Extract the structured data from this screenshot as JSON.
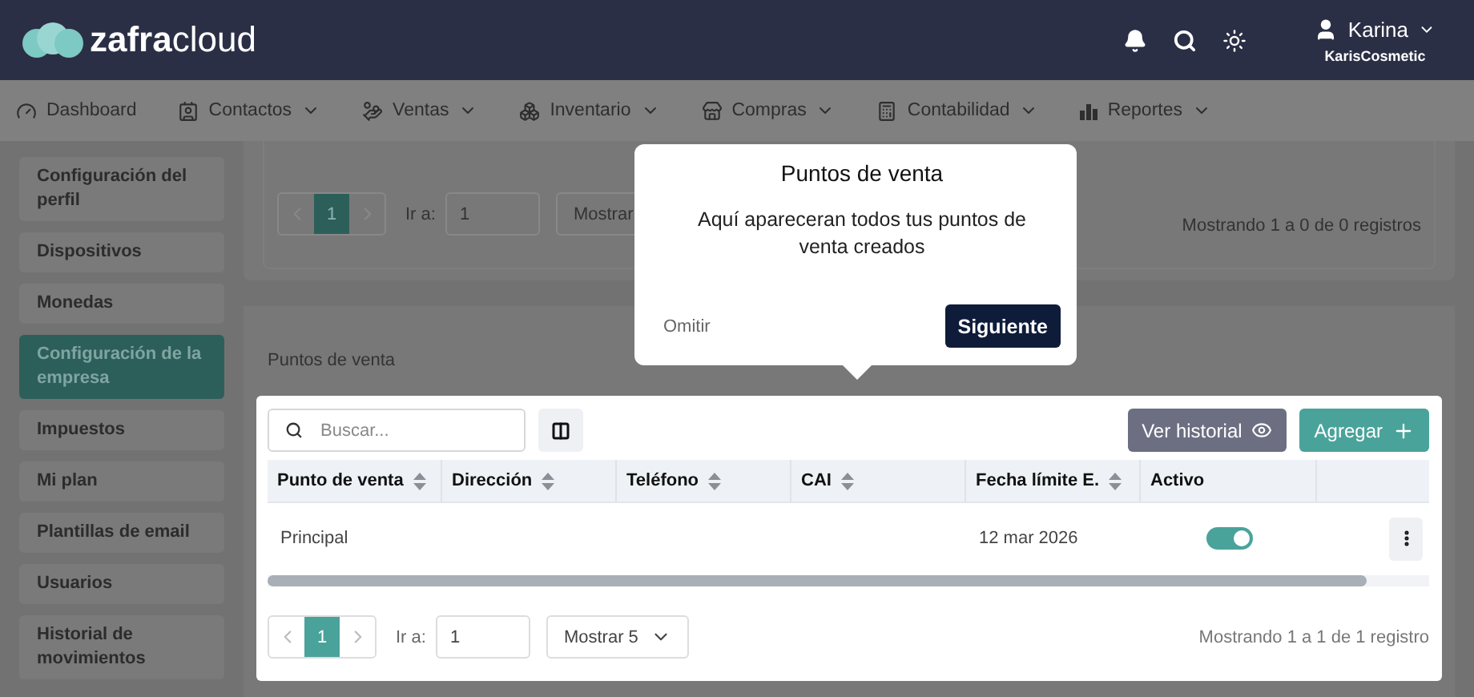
{
  "header": {
    "logo": {
      "bold": "zafra",
      "light": "cloud"
    },
    "user": {
      "name": "Karina",
      "company": "KarisCosmetic"
    }
  },
  "nav": [
    {
      "kind": "dashboard",
      "label": "Dashboard",
      "dropdown": false
    },
    {
      "kind": "contacts",
      "label": "Contactos",
      "dropdown": true
    },
    {
      "kind": "sales",
      "label": "Ventas",
      "dropdown": true
    },
    {
      "kind": "inventory",
      "label": "Inventario",
      "dropdown": true
    },
    {
      "kind": "purchases",
      "label": "Compras",
      "dropdown": true
    },
    {
      "kind": "accounting",
      "label": "Contabilidad",
      "dropdown": true
    },
    {
      "kind": "reports",
      "label": "Reportes",
      "dropdown": true
    }
  ],
  "sidebar": {
    "items": [
      {
        "label": "Configuración del perfil",
        "selected": false
      },
      {
        "label": "Dispositivos",
        "selected": false
      },
      {
        "label": "Monedas",
        "selected": false
      },
      {
        "label": "Configuración de la empresa",
        "selected": true
      },
      {
        "label": "Impuestos",
        "selected": false
      },
      {
        "label": "Mi plan",
        "selected": false
      },
      {
        "label": "Plantillas de email",
        "selected": false
      },
      {
        "label": "Usuarios",
        "selected": false
      },
      {
        "label": "Historial de movimientos",
        "selected": false
      }
    ]
  },
  "upper_panel": {
    "pagination": {
      "page": "1",
      "goto_label": "Ir a:",
      "goto_value": "1",
      "page_size": "Mostrar"
    },
    "summary": "Mostrando 1 a 0 de 0 registros"
  },
  "section": {
    "title": "Puntos de venta",
    "toolbar": {
      "search": {
        "placeholder": "Buscar..."
      },
      "history_button": "Ver historial",
      "add_button": "Agregar"
    },
    "table": {
      "columns": [
        {
          "label": "Punto de venta",
          "sortable": true
        },
        {
          "label": "Dirección",
          "sortable": true
        },
        {
          "label": "Teléfono",
          "sortable": true
        },
        {
          "label": "CAI",
          "sortable": true
        },
        {
          "label": "Fecha límite E.",
          "sortable": true
        },
        {
          "label": "Activo",
          "sortable": false
        }
      ],
      "rows": [
        {
          "cells": [
            "Principal",
            "",
            "",
            "",
            "12 mar 2026"
          ],
          "active": true
        }
      ]
    },
    "pagination": {
      "page": "1",
      "goto_label": "Ir a:",
      "goto_value": "1",
      "page_size": "Mostrar 5"
    },
    "summary": "Mostrando 1 a 1 de 1 registro"
  },
  "tour_popover": {
    "title": "Puntos de venta",
    "body": "Aquí apareceran todos tus puntos de venta creados",
    "skip": "Omitir",
    "next": "Siguiente"
  }
}
